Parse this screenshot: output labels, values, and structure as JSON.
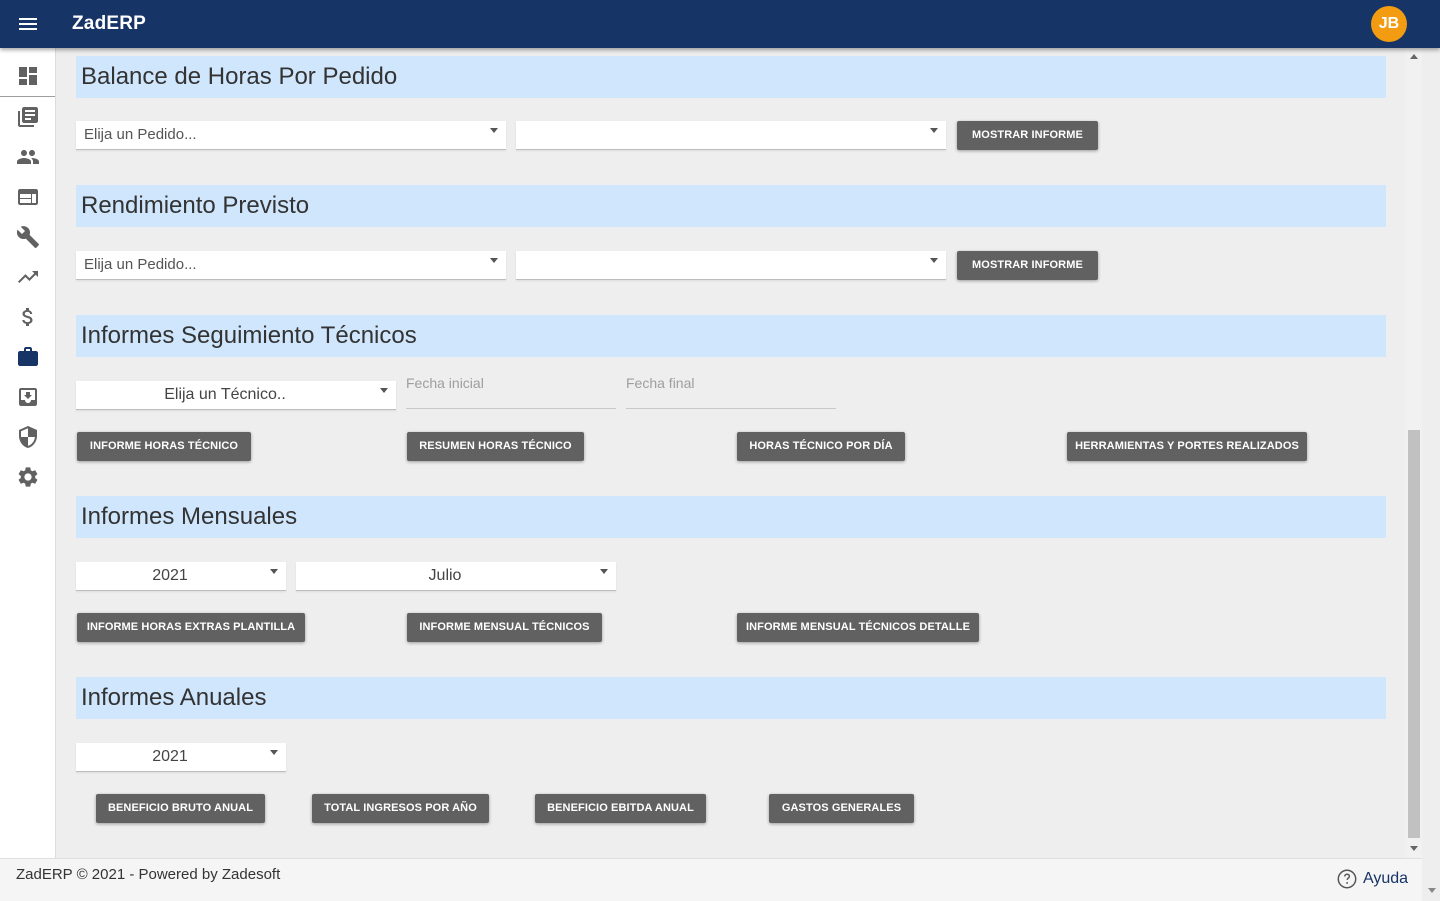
{
  "app": {
    "title": "ZadERP",
    "avatar_initials": "JB"
  },
  "colors": {
    "topbar": "#173466",
    "avatar": "#f39c12",
    "section_header": "#cfe6fd",
    "button": "#616161"
  },
  "sidebar": {
    "items": [
      {
        "icon": "dashboard-icon"
      },
      {
        "icon": "library-books-icon"
      },
      {
        "icon": "people-icon"
      },
      {
        "icon": "web-window-icon"
      },
      {
        "icon": "wrench-icon"
      },
      {
        "icon": "trending-up-icon"
      },
      {
        "icon": "dollar-icon"
      },
      {
        "icon": "briefcase-icon",
        "active": true
      },
      {
        "icon": "archive-icon"
      },
      {
        "icon": "shield-icon"
      },
      {
        "icon": "settings-gear-icon"
      }
    ]
  },
  "sections": {
    "balance": {
      "title": "Balance de Horas Por Pedido",
      "pedido_select": "Elija un Pedido...",
      "second_select": "",
      "button": "MOSTRAR INFORME"
    },
    "rendimiento": {
      "title": "Rendimiento Previsto",
      "pedido_select": "Elija un Pedido...",
      "second_select": "",
      "button": "MOSTRAR INFORME"
    },
    "seguimiento": {
      "title": "Informes Seguimiento Técnicos",
      "tecnico_select": "Elija un Técnico..",
      "fecha_inicial_placeholder": "Fecha inicial",
      "fecha_final_placeholder": "Fecha final",
      "buttons": [
        "INFORME HORAS TÉCNICO",
        "RESUMEN HORAS TÉCNICO",
        "HORAS TÉCNICO POR DÍA",
        "HERRAMIENTAS Y PORTES REALIZADOS"
      ]
    },
    "mensuales": {
      "title": "Informes Mensuales",
      "year_select": "2021",
      "month_select": "Julio",
      "buttons": [
        "INFORME HORAS EXTRAS PLANTILLA",
        "INFORME MENSUAL TÉCNICOS",
        "INFORME MENSUAL TÉCNICOS DETALLE"
      ]
    },
    "anuales": {
      "title": "Informes Anuales",
      "year_select": "2021",
      "buttons": [
        "BENEFICIO BRUTO ANUAL",
        "TOTAL INGRESOS POR AÑO",
        "BENEFICIO EBITDA ANUAL",
        "GASTOS GENERALES"
      ]
    }
  },
  "footer": {
    "copyright": "ZadERP © 2021 - Powered by Zadesoft",
    "help_label": "Ayuda"
  }
}
